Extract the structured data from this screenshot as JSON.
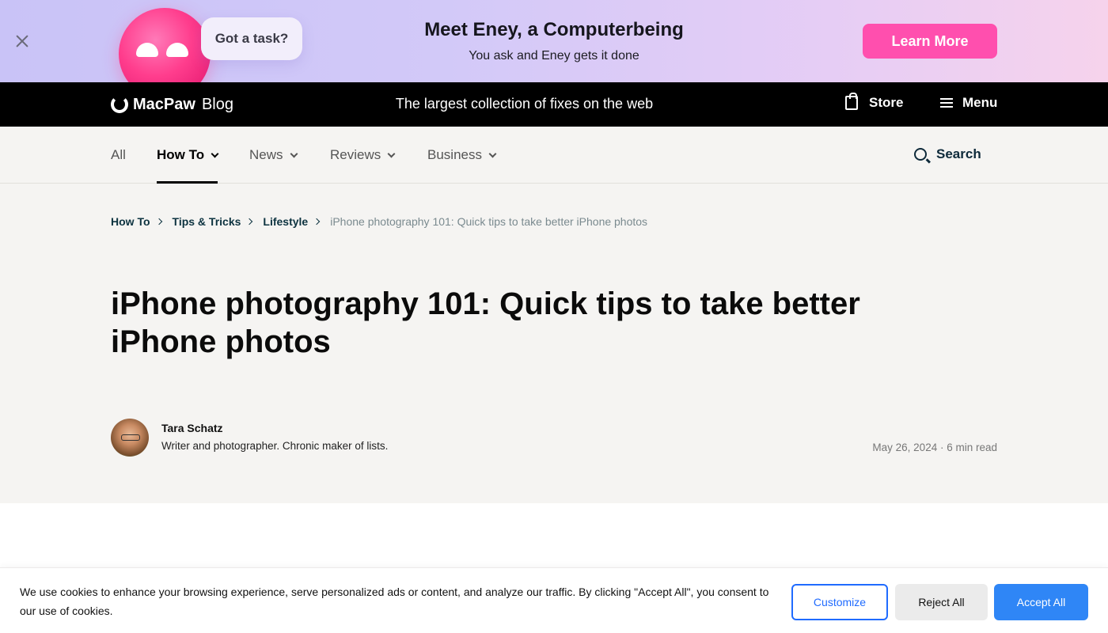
{
  "promo": {
    "bubble_text": "Got a task?",
    "title": "Meet Eney, a Computerbeing",
    "subtitle": "You ask and Eney gets it done",
    "cta_label": "Learn More",
    "accent": "#ff4fae"
  },
  "header": {
    "logo_text": "MacPaw",
    "logo_suffix": "Blog",
    "tagline": "The largest collection of fixes on the web",
    "store_label": "Store",
    "menu_label": "Menu"
  },
  "categories": {
    "items": [
      {
        "label": "All"
      },
      {
        "label": "How To"
      },
      {
        "label": "News"
      },
      {
        "label": "Reviews"
      },
      {
        "label": "Business"
      }
    ],
    "active": "How To",
    "search_label": "Search"
  },
  "breadcrumb": {
    "items": [
      "How To",
      "Tips & Tricks",
      "Lifestyle"
    ],
    "current": "iPhone photography 101: Quick tips to take better iPhone photos"
  },
  "article": {
    "title": "iPhone photography 101: Quick tips to take better iPhone photos",
    "author": "Tara Schatz",
    "author_bio": "Writer and photographer. Chronic maker of lists.",
    "meta": "May 26, 2024 · 6 min read"
  },
  "cookie": {
    "text": "We use cookies to enhance your browsing experience, serve personalized ads or content, and analyze our traffic. By clicking \"Accept All\", you consent to our use of cookies.",
    "customize_label": "Customize",
    "reject_label": "Reject All",
    "accept_label": "Accept All",
    "accent": "#2f86f6"
  }
}
